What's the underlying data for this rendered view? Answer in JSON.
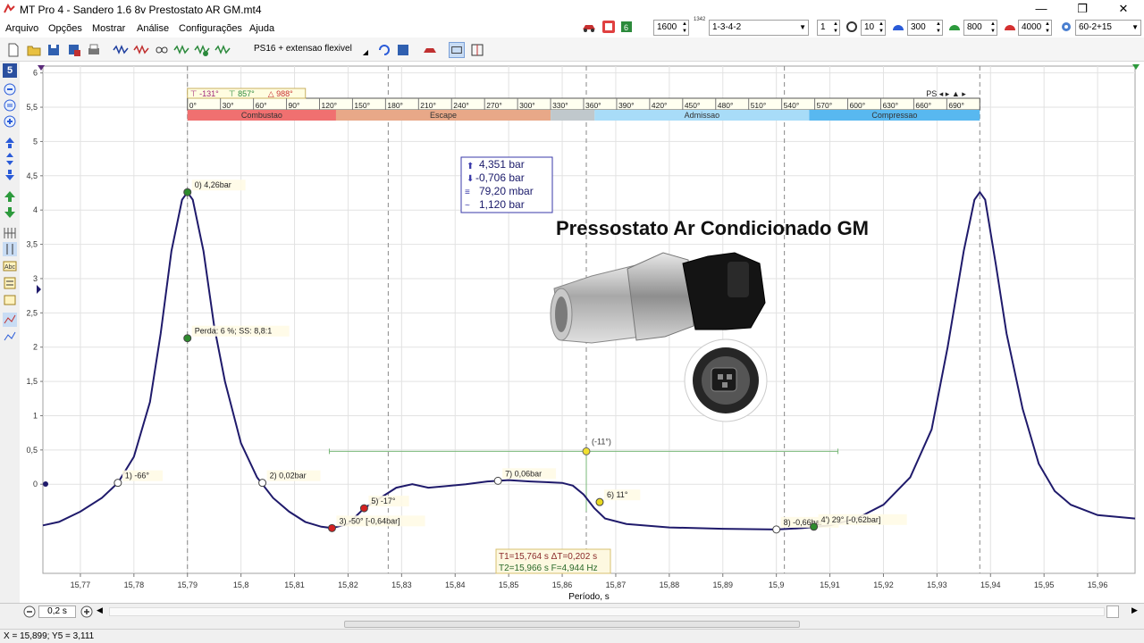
{
  "window": {
    "title": "MT Pro 4 - Sandero 1.6 8v Prestostato AR GM.mt4",
    "minimize": "—",
    "restore": "❐",
    "close": "✕"
  },
  "menu": [
    "Arquivo",
    "Opções",
    "Mostrar",
    "Análise",
    "Configurações",
    "Ajuda"
  ],
  "toolbar": {
    "probe_combo": "PS16 + extensao flexivel",
    "rpm_value": "1600",
    "firing_order": "1-3-4-2",
    "cylinder": "1",
    "teeth": "10",
    "v1": "300",
    "v2": "800",
    "v3": "4000",
    "wheel": "60-2+15",
    "rpm_badge": "1342"
  },
  "left_tools": {
    "channel": "5"
  },
  "colors": {
    "trace": "#1f1a6b",
    "combustao": "#f07070",
    "escape": "#e8a888",
    "admissao": "#a8dcf8",
    "compressao": "#58b8f0",
    "grid": "#e2e2e2"
  },
  "chart_data": {
    "type": "line",
    "xlabel": "Período, s",
    "xlim": [
      15.763,
      15.967
    ],
    "ylim": [
      -1.3,
      6.1
    ],
    "x_ticks": [
      "15,77",
      "15,78",
      "15,79",
      "15,8",
      "15,81",
      "15,82",
      "15,83",
      "15,84",
      "15,85",
      "15,86",
      "15,87",
      "15,88",
      "15,89",
      "15,9",
      "15,91",
      "15,92",
      "15,93",
      "15,94",
      "15,95",
      "15,96"
    ],
    "x_tick_values": [
      15.77,
      15.78,
      15.79,
      15.8,
      15.81,
      15.82,
      15.83,
      15.84,
      15.85,
      15.86,
      15.87,
      15.88,
      15.89,
      15.9,
      15.91,
      15.92,
      15.93,
      15.94,
      15.95,
      15.96
    ],
    "y_ticks": [
      "0",
      "0,5",
      "1",
      "1,5",
      "2",
      "2,5",
      "3",
      "3,5",
      "4",
      "4,5",
      "5",
      "5,5",
      "6"
    ],
    "y_tick_values": [
      0,
      0.5,
      1,
      1.5,
      2,
      2.5,
      3,
      3.5,
      4,
      4.5,
      5,
      5.5,
      6
    ],
    "series": [
      {
        "x": [
          15.763,
          15.766,
          15.77,
          15.774,
          15.777,
          15.78,
          15.783,
          15.785,
          15.787,
          15.789,
          15.79,
          15.791,
          15.793,
          15.795,
          15.797,
          15.8,
          15.803,
          15.806,
          15.809,
          15.812,
          15.815,
          15.817,
          15.82,
          15.823,
          15.826,
          15.829,
          15.832,
          15.835,
          15.838,
          15.842,
          15.846,
          15.85,
          15.854,
          15.857,
          15.86,
          15.862,
          15.864,
          15.866,
          15.868,
          15.872,
          15.88,
          15.89,
          15.9,
          15.905,
          15.91,
          15.915,
          15.92,
          15.925,
          15.929,
          15.932,
          15.935,
          15.937,
          15.938,
          15.939,
          15.941,
          15.943,
          15.946,
          15.949,
          15.952,
          15.955,
          15.96,
          15.967
        ],
        "y": [
          -0.6,
          -0.55,
          -0.4,
          -0.2,
          0.02,
          0.4,
          1.2,
          2.2,
          3.4,
          4.15,
          4.26,
          4.15,
          3.4,
          2.3,
          1.5,
          0.6,
          0.1,
          -0.2,
          -0.4,
          -0.55,
          -0.62,
          -0.64,
          -0.58,
          -0.35,
          -0.2,
          -0.05,
          0.0,
          -0.05,
          -0.03,
          0.0,
          0.04,
          0.06,
          0.04,
          0.03,
          0.02,
          -0.02,
          -0.15,
          -0.35,
          -0.5,
          -0.58,
          -0.63,
          -0.65,
          -0.66,
          -0.64,
          -0.6,
          -0.5,
          -0.3,
          0.1,
          0.8,
          2.0,
          3.4,
          4.15,
          4.26,
          4.15,
          3.2,
          2.2,
          1.1,
          0.3,
          -0.1,
          -0.3,
          -0.45,
          -0.5
        ]
      }
    ],
    "markers": [
      {
        "x": 15.777,
        "y": 0.02,
        "label": "1)  -66°",
        "color": "#ffffff"
      },
      {
        "x": 15.79,
        "y": 4.26,
        "label": "0)  4,26bar",
        "color": "#2e8b2e"
      },
      {
        "x": 15.79,
        "y": 2.13,
        "label": "Perda: 6 %; SS: 8,8:1",
        "color": "#2e8b2e"
      },
      {
        "x": 15.804,
        "y": 0.02,
        "label": "2)  0,02bar",
        "color": "#ffffff"
      },
      {
        "x": 15.817,
        "y": -0.64,
        "label": "3)  -50° [-0,64bar]",
        "color": "#d42020"
      },
      {
        "x": 15.823,
        "y": -0.35,
        "label": "5)  -17°",
        "color": "#d42020"
      },
      {
        "x": 15.848,
        "y": 0.05,
        "label": "7)  0,06bar",
        "color": "#ffffff"
      },
      {
        "x": 15.867,
        "y": -0.26,
        "label": "6)  11°",
        "color": "#e8d820"
      },
      {
        "x": 15.9,
        "y": -0.66,
        "label": "8)  -0,66bar",
        "color": "#ffffff"
      },
      {
        "x": 15.907,
        "y": -0.62,
        "label": "4')  29° [-0,62bar]",
        "color": "#2e8b2e"
      }
    ],
    "ruler": {
      "x_start": 15.8165,
      "x_end": 15.9115,
      "y": 0.48,
      "center_x": 15.8645,
      "label": "(-11°)"
    },
    "stats_box": [
      "4,351 bar",
      "-0,706 bar",
      "79,20 mbar",
      "1,120 bar"
    ],
    "time_box": [
      "T1=15,764 s  ΔT=0,202 s",
      "T2=15,966 s  F=4,944 Hz"
    ],
    "degree_ruler": {
      "labels": [
        "0°",
        "30°",
        "60°",
        "90°",
        "120°",
        "150°",
        "180°",
        "210°",
        "240°",
        "270°",
        "300°",
        "330°",
        "360°",
        "390°",
        "420°",
        "450°",
        "480°",
        "510°",
        "540°",
        "570°",
        "600°",
        "630°",
        "660°",
        "690°"
      ],
      "readouts": [
        "-131°",
        "857°",
        "988°"
      ],
      "ps": "PS",
      "phases": [
        {
          "name": "Combustao",
          "from": 0,
          "to": 135
        },
        {
          "name": "Escape",
          "from": 135,
          "to": 330
        },
        {
          "name": "",
          "from": 330,
          "to": 370
        },
        {
          "name": "Admissao",
          "from": 370,
          "to": 565
        },
        {
          "name": "Compressao",
          "from": 565,
          "to": 720
        }
      ]
    },
    "photo_caption": "Pressostato Ar Condicionado GM"
  },
  "bottom": {
    "time_per_div": "0,2 s"
  },
  "status": {
    "cursor": "X = 15,899; Y5 = 3,111"
  }
}
